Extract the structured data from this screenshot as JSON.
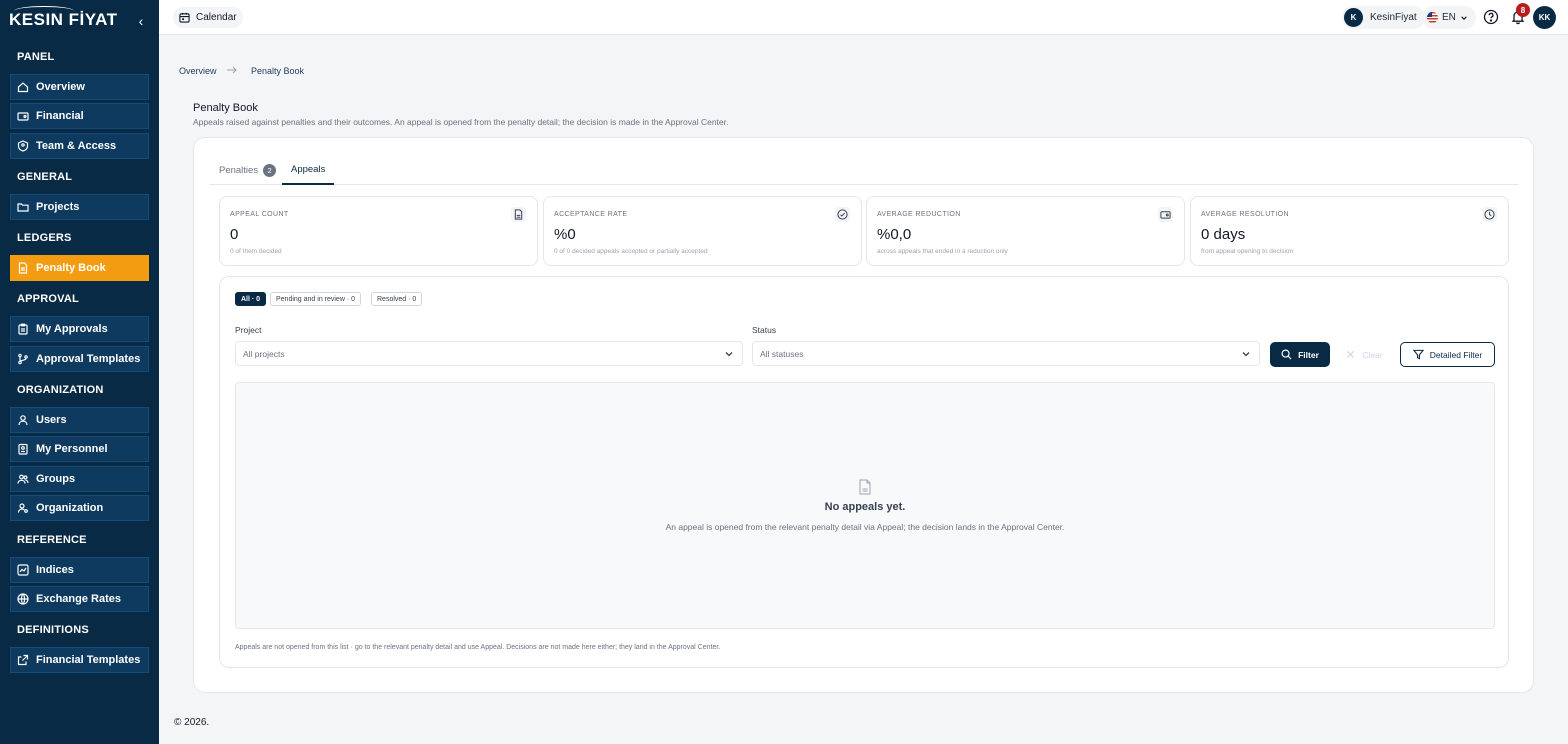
{
  "app": {
    "logo": "KESIN FİYAT",
    "collapse_glyph": "‹"
  },
  "sidebar": {
    "sections": [
      {
        "title": "PANEL",
        "items": [
          {
            "label": "Overview",
            "icon": "home-icon"
          },
          {
            "label": "Financial",
            "icon": "wallet-icon"
          },
          {
            "label": "Team & Access",
            "icon": "user-shield-icon"
          }
        ]
      },
      {
        "title": "GENERAL",
        "items": [
          {
            "label": "Projects",
            "icon": "folder-icon"
          }
        ]
      },
      {
        "title": "LEDGERS",
        "items": [
          {
            "label": "Penalty Book",
            "icon": "receipt-icon",
            "active": true
          }
        ]
      },
      {
        "title": "APPROVAL",
        "items": [
          {
            "label": "My Approvals",
            "icon": "clipboard-icon"
          },
          {
            "label": "Approval Templates",
            "icon": "git-branch-icon"
          }
        ]
      },
      {
        "title": "ORGANIZATION",
        "items": [
          {
            "label": "Users",
            "icon": "user-icon"
          },
          {
            "label": "My Personnel",
            "icon": "id-card-icon"
          },
          {
            "label": "Groups",
            "icon": "users-icon"
          },
          {
            "label": "Organization",
            "icon": "user-cog-icon"
          }
        ]
      },
      {
        "title": "REFERENCE",
        "items": [
          {
            "label": "Indices",
            "icon": "chart-icon"
          },
          {
            "label": "Exchange Rates",
            "icon": "globe-icon"
          }
        ]
      },
      {
        "title": "DEFINITIONS",
        "items": [
          {
            "label": "Financial Templates",
            "icon": "external-doc-icon"
          }
        ]
      }
    ]
  },
  "topbar": {
    "calendar_label": "Calendar",
    "user_initial": "K",
    "user_name": "KesinFiyat",
    "language": "EN",
    "notification_count": "8",
    "avatar_initials": "KK"
  },
  "breadcrumb": {
    "home": "Overview",
    "current": "Penalty Book"
  },
  "page": {
    "title": "Penalty Book",
    "description": "Appeals raised against penalties and their outcomes. An appeal is opened from the penalty detail; the decision is made in the Approval Center."
  },
  "tabs": [
    {
      "label": "Penalties",
      "count": "2"
    },
    {
      "label": "Appeals",
      "active": true
    }
  ],
  "stats": [
    {
      "label": "APPEAL COUNT",
      "value": "0",
      "sub": "0 of them decided",
      "icon": "receipt-icon"
    },
    {
      "label": "ACCEPTANCE RATE",
      "value": "%0",
      "sub": "0 of 0 decided appeals accepted or partially accepted",
      "icon": "check-circle-icon"
    },
    {
      "label": "AVERAGE REDUCTION",
      "value": "%0,0",
      "sub": "across appeals that ended in a reduction only",
      "icon": "wallet-icon"
    },
    {
      "label": "AVERAGE RESOLUTION",
      "value": "0 days",
      "sub": "from appeal opening to decision",
      "icon": "clock-icon"
    }
  ],
  "chips": [
    {
      "label": "All · 0",
      "active": true
    },
    {
      "label": "Pending and in review · 0"
    },
    {
      "label": "Resolved · 0"
    }
  ],
  "filters": {
    "project_label": "Project",
    "project_value": "All projects",
    "status_label": "Status",
    "status_value": "All statuses",
    "filter_btn": "Filter",
    "clear_btn": "Clear",
    "detailed_btn": "Detailed Filter"
  },
  "empty": {
    "title": "No appeals yet.",
    "description": "An appeal is opened from the relevant penalty detail via Appeal; the decision lands in the Approval Center."
  },
  "footnote": "Appeals are not opened from this list · go to the relevant penalty detail and use Appeal. Decisions are not made here either; they land in the Approval Center.",
  "copyright": "© 2026."
}
